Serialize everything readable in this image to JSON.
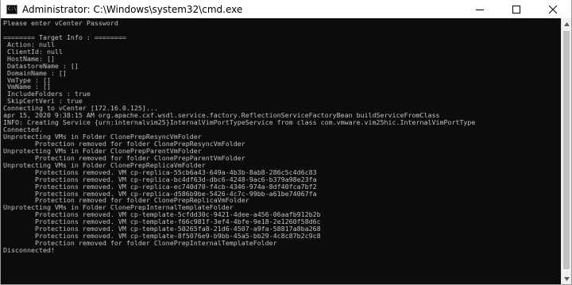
{
  "window": {
    "title": "Administrator: C:\\Windows\\system32\\cmd.exe",
    "icon_text": "C:\\"
  },
  "console": {
    "lines": [
      "Please enter vCenter Password",
      "",
      "======== Target Info : ========",
      " Action: null",
      " ClientId: null",
      " HostName: []",
      " DatastoreName : []",
      " DomainName : []",
      " VmType : []",
      " VmName : []",
      " IncludeFolders : true",
      " SkipCertVeri : true",
      "Connecting to vCenter [172.16.0.125]...",
      "apr 15, 2020 9:38:15 AM org.apache.cxf.wsdl.service.factory.ReflectionServiceFactoryBean buildServiceFromClass",
      "INFO: Creating Service {urn:internalvim25}InternalVimPortTypeService from class com.vmware.vim25hic.InternalVimPortType",
      "Connected.",
      "Unprotecting VMs in Folder ClonePrepResyncVmFolder",
      "        Protection removed for folder ClonePrepResyncVmFolder",
      "Unprotecting VMs in Folder ClonePrepParentVmFolder",
      "        Protection removed for folder ClonePrepParentVmFolder",
      "Unprotecting VMs in Folder ClonePrepReplicaVmFolder",
      "        Protections removed. VM cp-replica-55cb6a43-649a-4b3b-8ab8-286c5c4d6c83",
      "        Protections removed. VM cp-replica-bc4df63d-dbc6-4248-9ac6-b379a98e23fa",
      "        Protections removed. VM cp-replica-ec740d70-f4cb-4346-974a-8df40fca7bf2",
      "        Protections removed. VM cp-replica-d586b9be-5426-4c7c-99bb-a61be74067fa",
      "        Protection removed for folder ClonePrepReplicaVmFolder",
      "Unprotecting VMs in Folder ClonePrepInternalTemplateFolder",
      "        Protections removed. VM cp-template-5cfdd30c-9421-4dee-a456-06aafb912b2b",
      "        Protections removed. VM cp-template-f66c981f-3ef4-4bfe-9e18-2e1260f58d6c",
      "        Protections removed. VM cp-template-50265fa8-21d6-4507-a9fa-58817a8ba268",
      "        Protections removed. VM cp-template-8f5076e9-b9bb-45a5-bb29-4c8c87b2c9c8",
      "        Protection removed for folder ClonePrepInternalTemplateFolder",
      "Disconnected!"
    ]
  },
  "colors": {
    "console_background": "#0c0c0c",
    "console_text": "#c0c0c0",
    "titlebar_background": "#ffffff"
  },
  "icons": {
    "minimize": "minimize-icon",
    "maximize": "maximize-icon",
    "close": "close-icon",
    "scroll_up": "scroll-up-arrow-icon",
    "scroll_down": "scroll-down-arrow-icon"
  }
}
